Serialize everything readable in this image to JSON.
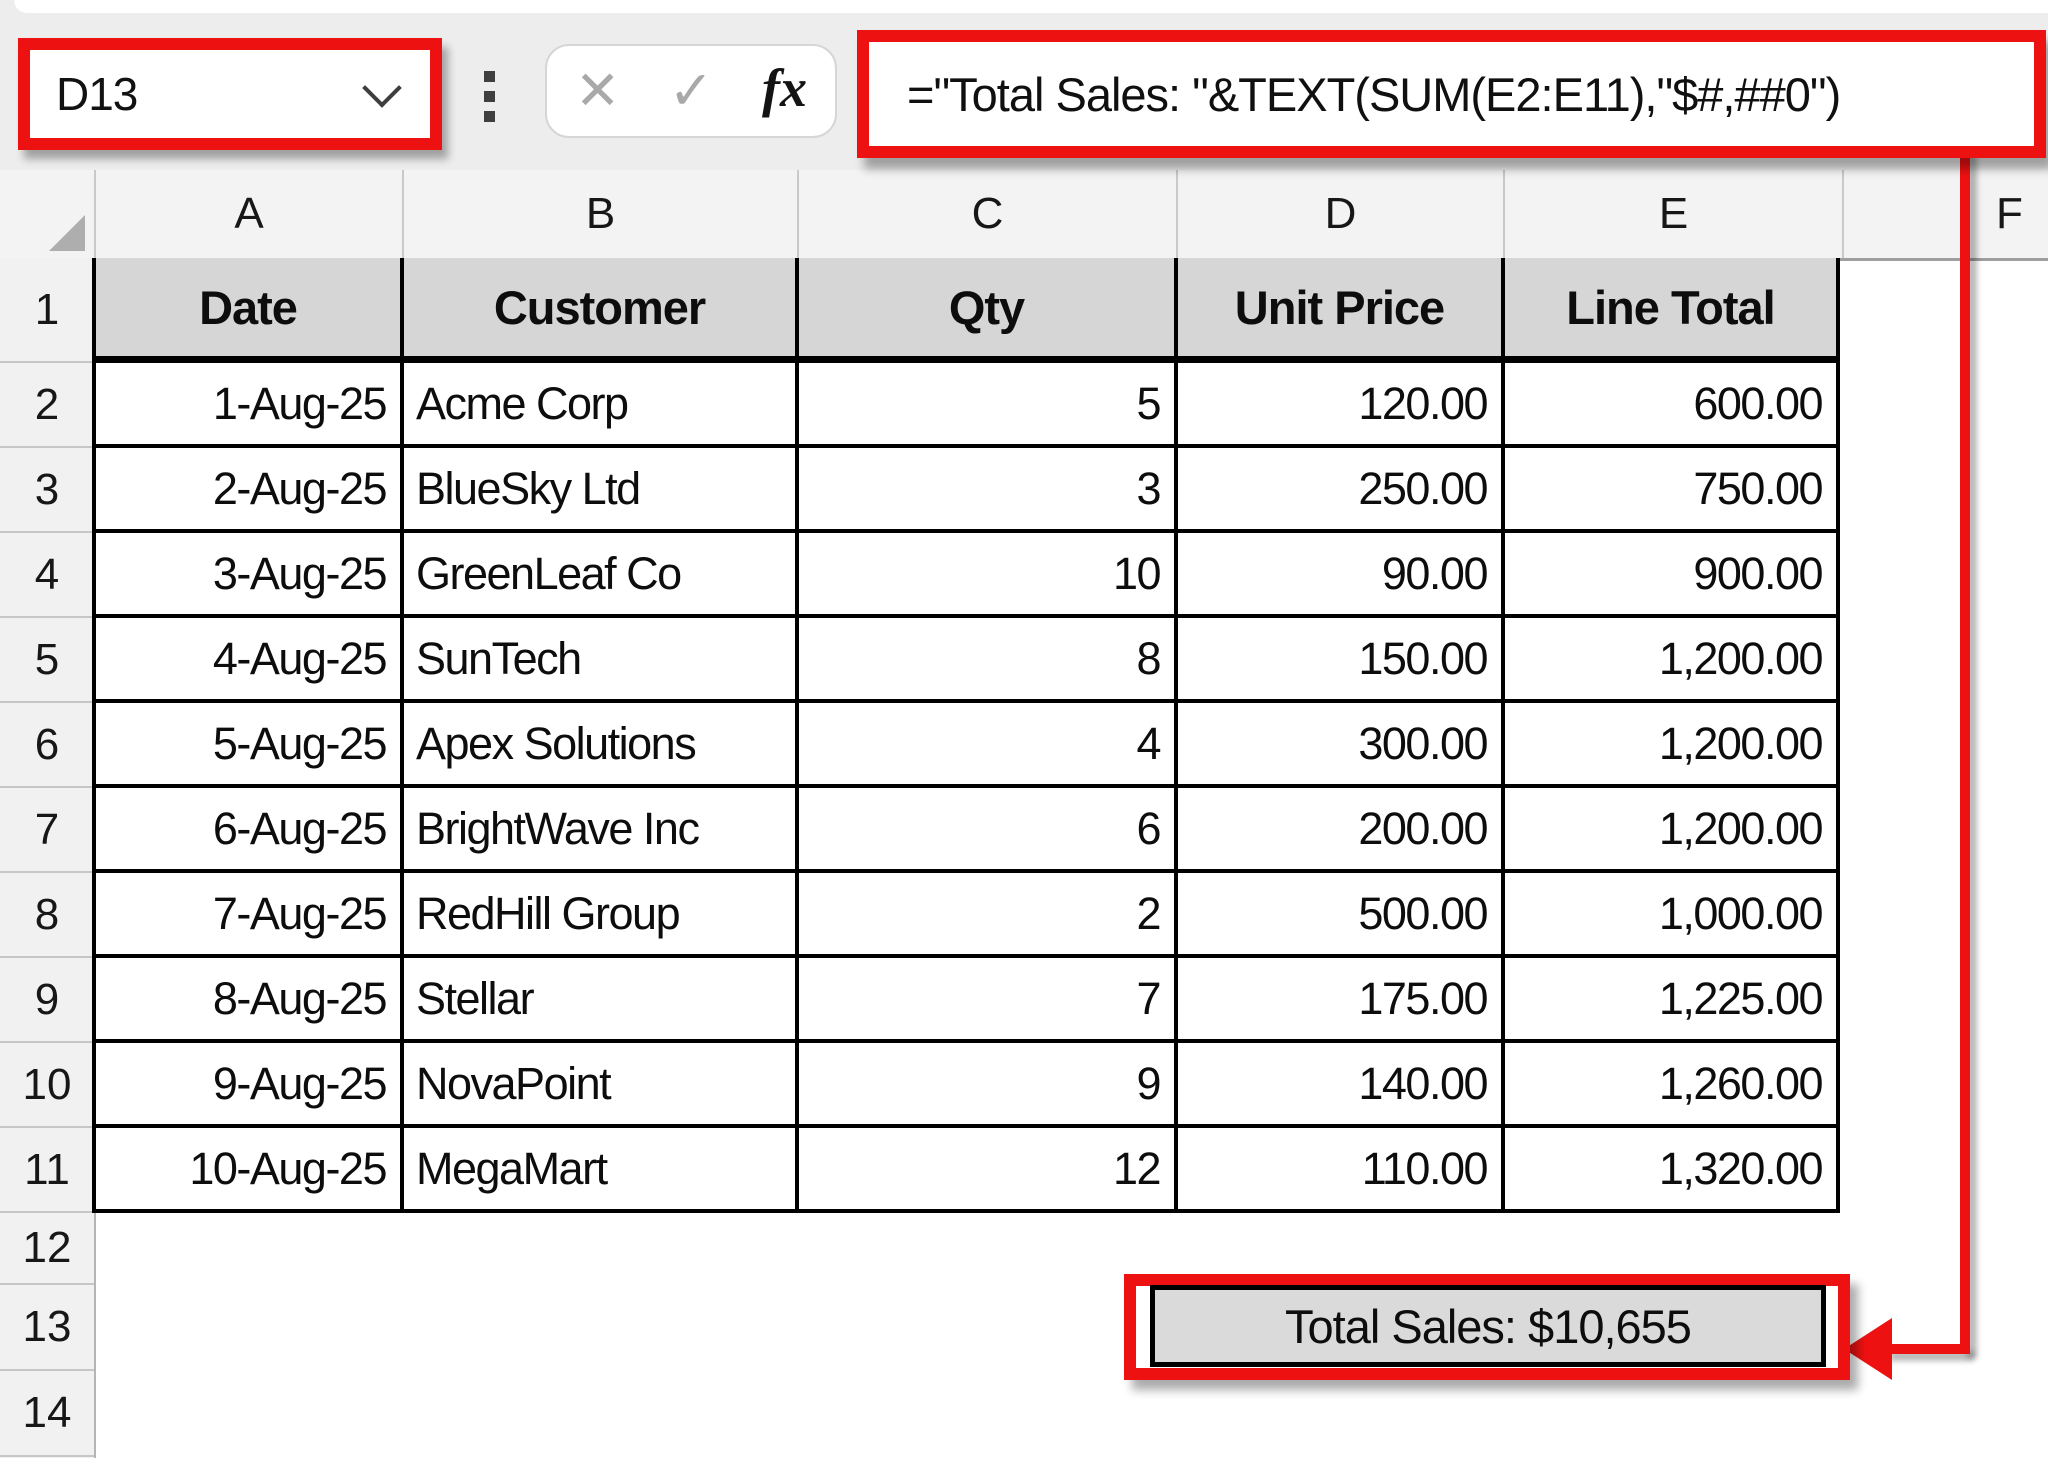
{
  "toolbar": {
    "name_box_value": "D13",
    "cancel_icon": "✕",
    "enter_icon": "✓",
    "fx_icon": "fx",
    "formula": "=\"Total Sales: \"&TEXT(SUM(E2:E11),\"$#,##0\")"
  },
  "sheet": {
    "column_letters": [
      "A",
      "B",
      "C",
      "D",
      "E",
      "F"
    ],
    "row_numbers": [
      "1",
      "2",
      "3",
      "4",
      "5",
      "6",
      "7",
      "8",
      "9",
      "10",
      "11",
      "12",
      "13",
      "14"
    ],
    "column_headers": [
      "Date",
      "Customer",
      "Qty",
      "Unit Price",
      "Line Total"
    ],
    "rows": [
      [
        "1-Aug-25",
        "Acme Corp",
        "5",
        "120.00",
        "600.00"
      ],
      [
        "2-Aug-25",
        "BlueSky Ltd",
        "3",
        "250.00",
        "750.00"
      ],
      [
        "3-Aug-25",
        "GreenLeaf Co",
        "10",
        "90.00",
        "900.00"
      ],
      [
        "4-Aug-25",
        "SunTech",
        "8",
        "150.00",
        "1,200.00"
      ],
      [
        "5-Aug-25",
        "Apex Solutions",
        "4",
        "300.00",
        "1,200.00"
      ],
      [
        "6-Aug-25",
        "BrightWave Inc",
        "6",
        "200.00",
        "1,200.00"
      ],
      [
        "7-Aug-25",
        "RedHill Group",
        "2",
        "500.00",
        "1,000.00"
      ],
      [
        "8-Aug-25",
        "Stellar",
        "7",
        "175.00",
        "1,225.00"
      ],
      [
        "9-Aug-25",
        "NovaPoint",
        "9",
        "140.00",
        "1,260.00"
      ],
      [
        "10-Aug-25",
        "MegaMart",
        "12",
        "110.00",
        "1,320.00"
      ]
    ],
    "total_cell_text": "Total Sales: $10,655"
  },
  "colors": {
    "annotation_red": "#ee1111",
    "header_fill": "#d6d6d6",
    "total_fill": "#dadada"
  }
}
